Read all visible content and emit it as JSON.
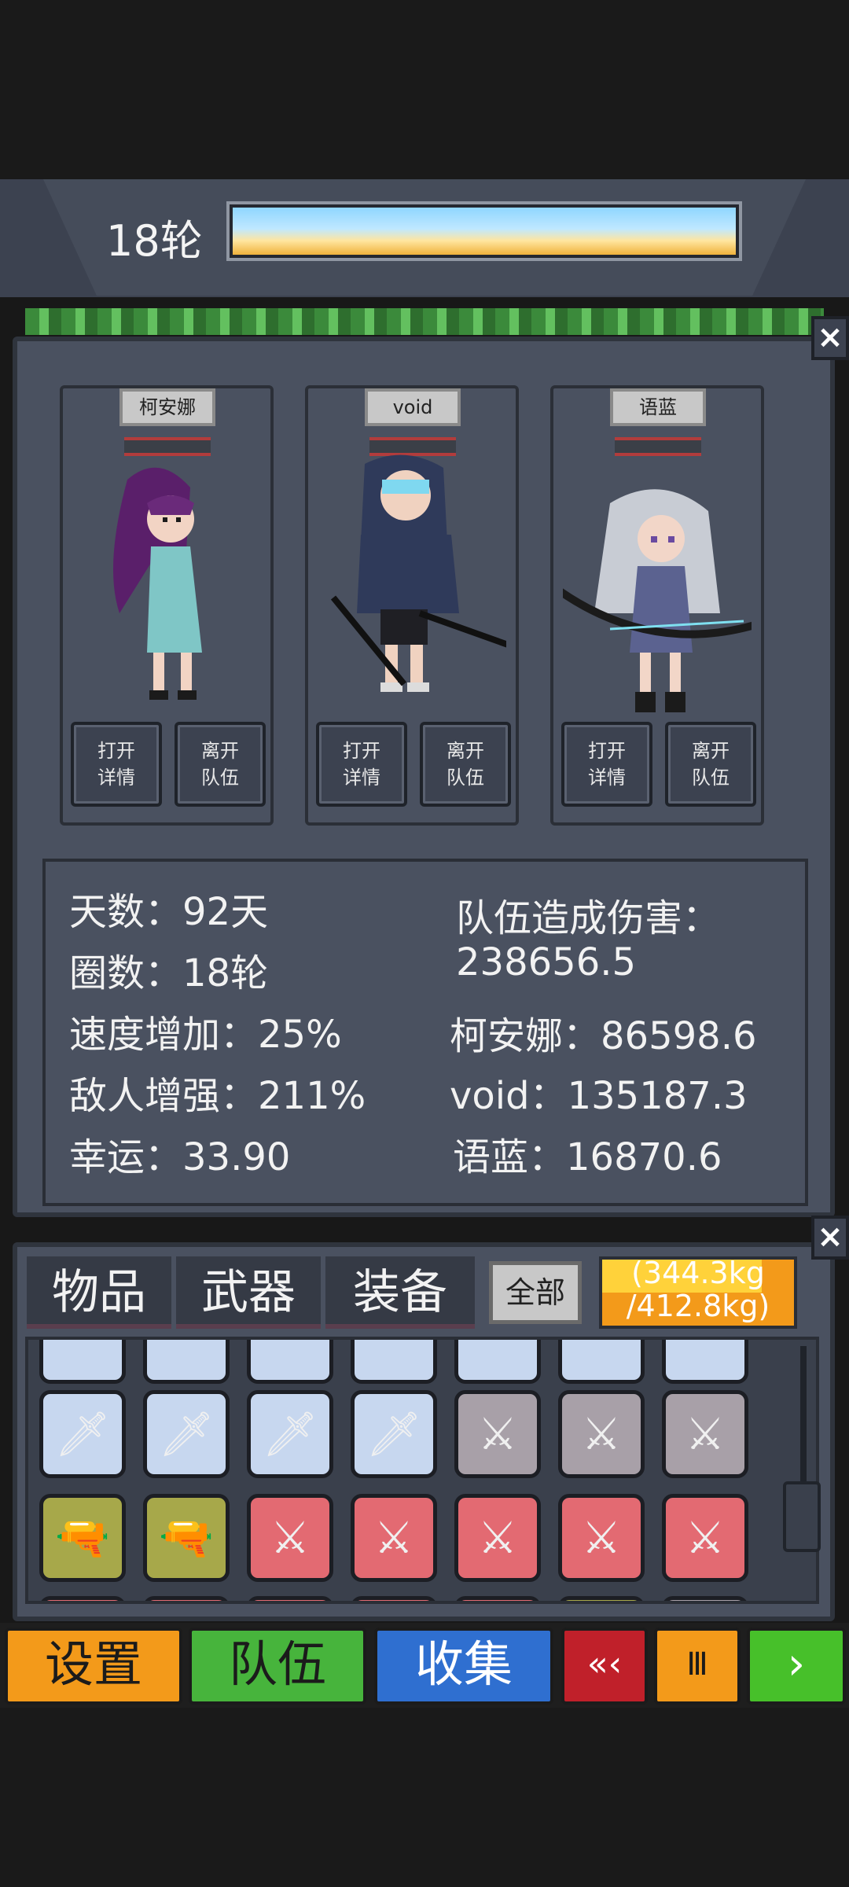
{
  "header": {
    "round_label": "18轮"
  },
  "party": {
    "members": [
      {
        "name": "柯安娜",
        "btn_details": "打开\n详情",
        "btn_leave": "离开\n队伍"
      },
      {
        "name": "void",
        "btn_details": "打开\n详情",
        "btn_leave": "离开\n队伍"
      },
      {
        "name": "语蓝",
        "btn_details": "打开\n详情",
        "btn_leave": "离开\n队伍"
      }
    ],
    "stats": {
      "days": "天数：92天",
      "rounds": "圈数：18轮",
      "speed": "速度增加：25%",
      "enemy": "敌人增强：211%",
      "luck": "幸运：33.90",
      "damage_title": "队伍造成伤害：",
      "damage_total": "238656.5",
      "damage_1": "柯安娜：86598.6",
      "damage_2": "void：135187.3",
      "damage_3": "语蓝：16870.6"
    },
    "close_icon": "×"
  },
  "inventory": {
    "tabs": [
      "物品",
      "武器",
      "装备"
    ],
    "filter": "全部",
    "weight_line1": "(344.3kg",
    "weight_line2": "/412.8kg)",
    "weight_fraction": 0.834,
    "close_icon": "×",
    "row1": [
      "sword",
      "sword",
      "sword",
      "sword",
      "dagger",
      "dagger",
      "dagger"
    ],
    "row2": [
      "pistol",
      "pistol",
      "twin-blade",
      "twin-blade",
      "twin-blade",
      "twin-blade",
      "twin-blade"
    ]
  },
  "nav": {
    "settings": "设置",
    "team": "队伍",
    "collect": "收集",
    "rewind": "«‹",
    "pause": "Ⅲ",
    "play": "›"
  },
  "colors": {
    "settings": "#f39a1a",
    "team": "#47b43c",
    "collect": "#2f6fd0",
    "rewind": "#c0202a",
    "pause": "#f39a1a",
    "play": "#47c02a"
  }
}
